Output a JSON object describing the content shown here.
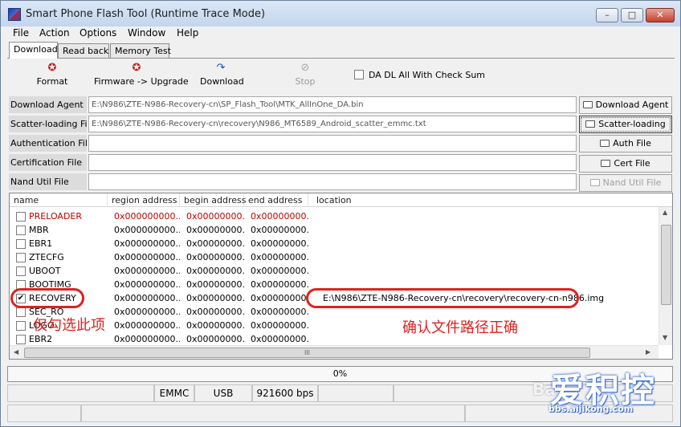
{
  "window": {
    "title": "Smart Phone Flash Tool (Runtime Trace Mode)",
    "controls": {
      "minimize": "–",
      "maximize": "□",
      "close": "✕"
    }
  },
  "menu": [
    "File",
    "Action",
    "Options",
    "Window",
    "Help"
  ],
  "tabs": [
    "Download",
    "Read back",
    "Memory Test"
  ],
  "toolbar": {
    "format": {
      "label": "Format",
      "icon": "format-icon"
    },
    "firmware_upgrade": {
      "label": "Firmware -> Upgrade",
      "icon": "upgrade-icon"
    },
    "download": {
      "label": "Download",
      "icon": "download-icon"
    },
    "stop": {
      "label": "Stop",
      "icon": "stop-icon"
    },
    "checksum_label": "DA DL All With Check Sum",
    "checksum_checked": false
  },
  "files": {
    "download_agent": {
      "label": "Download Agent",
      "value": "E:\\N986\\ZTE-N986-Recovery-cn\\SP_Flash_Tool\\MTK_AllInOne_DA.bin"
    },
    "scatter": {
      "label": "Scatter-loading File",
      "value": "E:\\N986\\ZTE-N986-Recovery-cn\\recovery\\N986_MT6589_Android_scatter_emmc.txt"
    },
    "authentication": {
      "label": "Authentication File",
      "value": ""
    },
    "certification": {
      "label": "Certification File",
      "value": ""
    },
    "nand_util": {
      "label": "Nand Util File",
      "value": ""
    }
  },
  "side_buttons": {
    "download_agent": "Download Agent",
    "scatter_loading": "Scatter-loading",
    "auth_file": "Auth File",
    "cert_file": "Cert File",
    "nand_util_file": "Nand Util File"
  },
  "table": {
    "columns": [
      "name",
      "region address",
      "begin address",
      "end address",
      "location"
    ],
    "rows": [
      {
        "name": "PRELOADER",
        "region": "0x000000000...",
        "begin": "0x00000000...",
        "end": "0x00000000...",
        "location": "",
        "checked": false,
        "highlight": true
      },
      {
        "name": "MBR",
        "region": "0x000000000...",
        "begin": "0x00000000...",
        "end": "0x00000000...",
        "location": "",
        "checked": false,
        "highlight": false
      },
      {
        "name": "EBR1",
        "region": "0x000000000...",
        "begin": "0x00000000...",
        "end": "0x00000000...",
        "location": "",
        "checked": false,
        "highlight": false
      },
      {
        "name": "ZTECFG",
        "region": "0x000000000...",
        "begin": "0x00000000...",
        "end": "0x00000000...",
        "location": "",
        "checked": false,
        "highlight": false
      },
      {
        "name": "UBOOT",
        "region": "0x000000000...",
        "begin": "0x00000000...",
        "end": "0x00000000...",
        "location": "",
        "checked": false,
        "highlight": false
      },
      {
        "name": "BOOTIMG",
        "region": "0x000000000...",
        "begin": "0x00000000...",
        "end": "0x00000000...",
        "location": "",
        "checked": false,
        "highlight": false
      },
      {
        "name": "RECOVERY",
        "region": "0x000000000...",
        "begin": "0x00000000...",
        "end": "0x00000000...",
        "location": "E:\\N986\\ZTE-N986-Recovery-cn\\recovery\\recovery-cn-n986.img",
        "checked": true,
        "highlight": false
      },
      {
        "name": "SEC_RO",
        "region": "0x000000000...",
        "begin": "0x00000000...",
        "end": "0x00000000...",
        "location": "",
        "checked": false,
        "highlight": false
      },
      {
        "name": "LOGO",
        "region": "0x000000000...",
        "begin": "0x00000000...",
        "end": "0x00000000...",
        "location": "",
        "checked": false,
        "highlight": false
      },
      {
        "name": "EBR2",
        "region": "0x000000000...",
        "begin": "0x00000000...",
        "end": "0x00000000...",
        "location": "",
        "checked": false,
        "highlight": false
      }
    ],
    "hscroll_grip": "III"
  },
  "progress": {
    "text": "0%",
    "fraction": 0.0
  },
  "status": {
    "storage": "EMMC",
    "port": "USB",
    "baud": "921600 bps"
  },
  "annotations": {
    "check_only_this": "仅勾选此项",
    "confirm_path": "确认文件路径正确"
  },
  "watermark": {
    "main": "爱积控",
    "url": "bbs.aijikong.com",
    "baidu": "Bai"
  },
  "colors": {
    "highlight_text": "#c00000",
    "annotation": "#e02020",
    "progress_fill": "#4fb04b"
  }
}
